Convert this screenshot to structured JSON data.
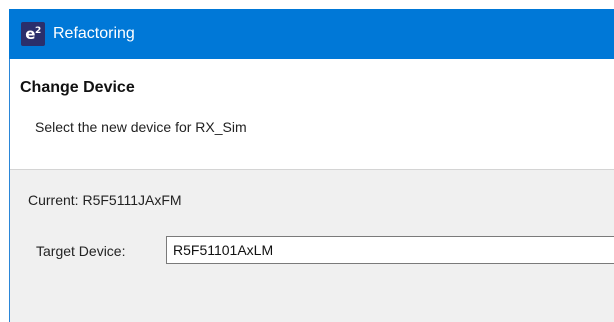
{
  "window": {
    "icon_label": "e²",
    "title": "Refactoring"
  },
  "header": {
    "title": "Change Device",
    "description": "Select the new device for RX_Sim"
  },
  "content": {
    "current_text": "Current: R5F5111JAxFM",
    "target_label": "Target Device:",
    "target_value": "R5F51101AxLM"
  },
  "colors": {
    "titlebar": "#0078d7",
    "panel_bg": "#f0f0f0"
  }
}
